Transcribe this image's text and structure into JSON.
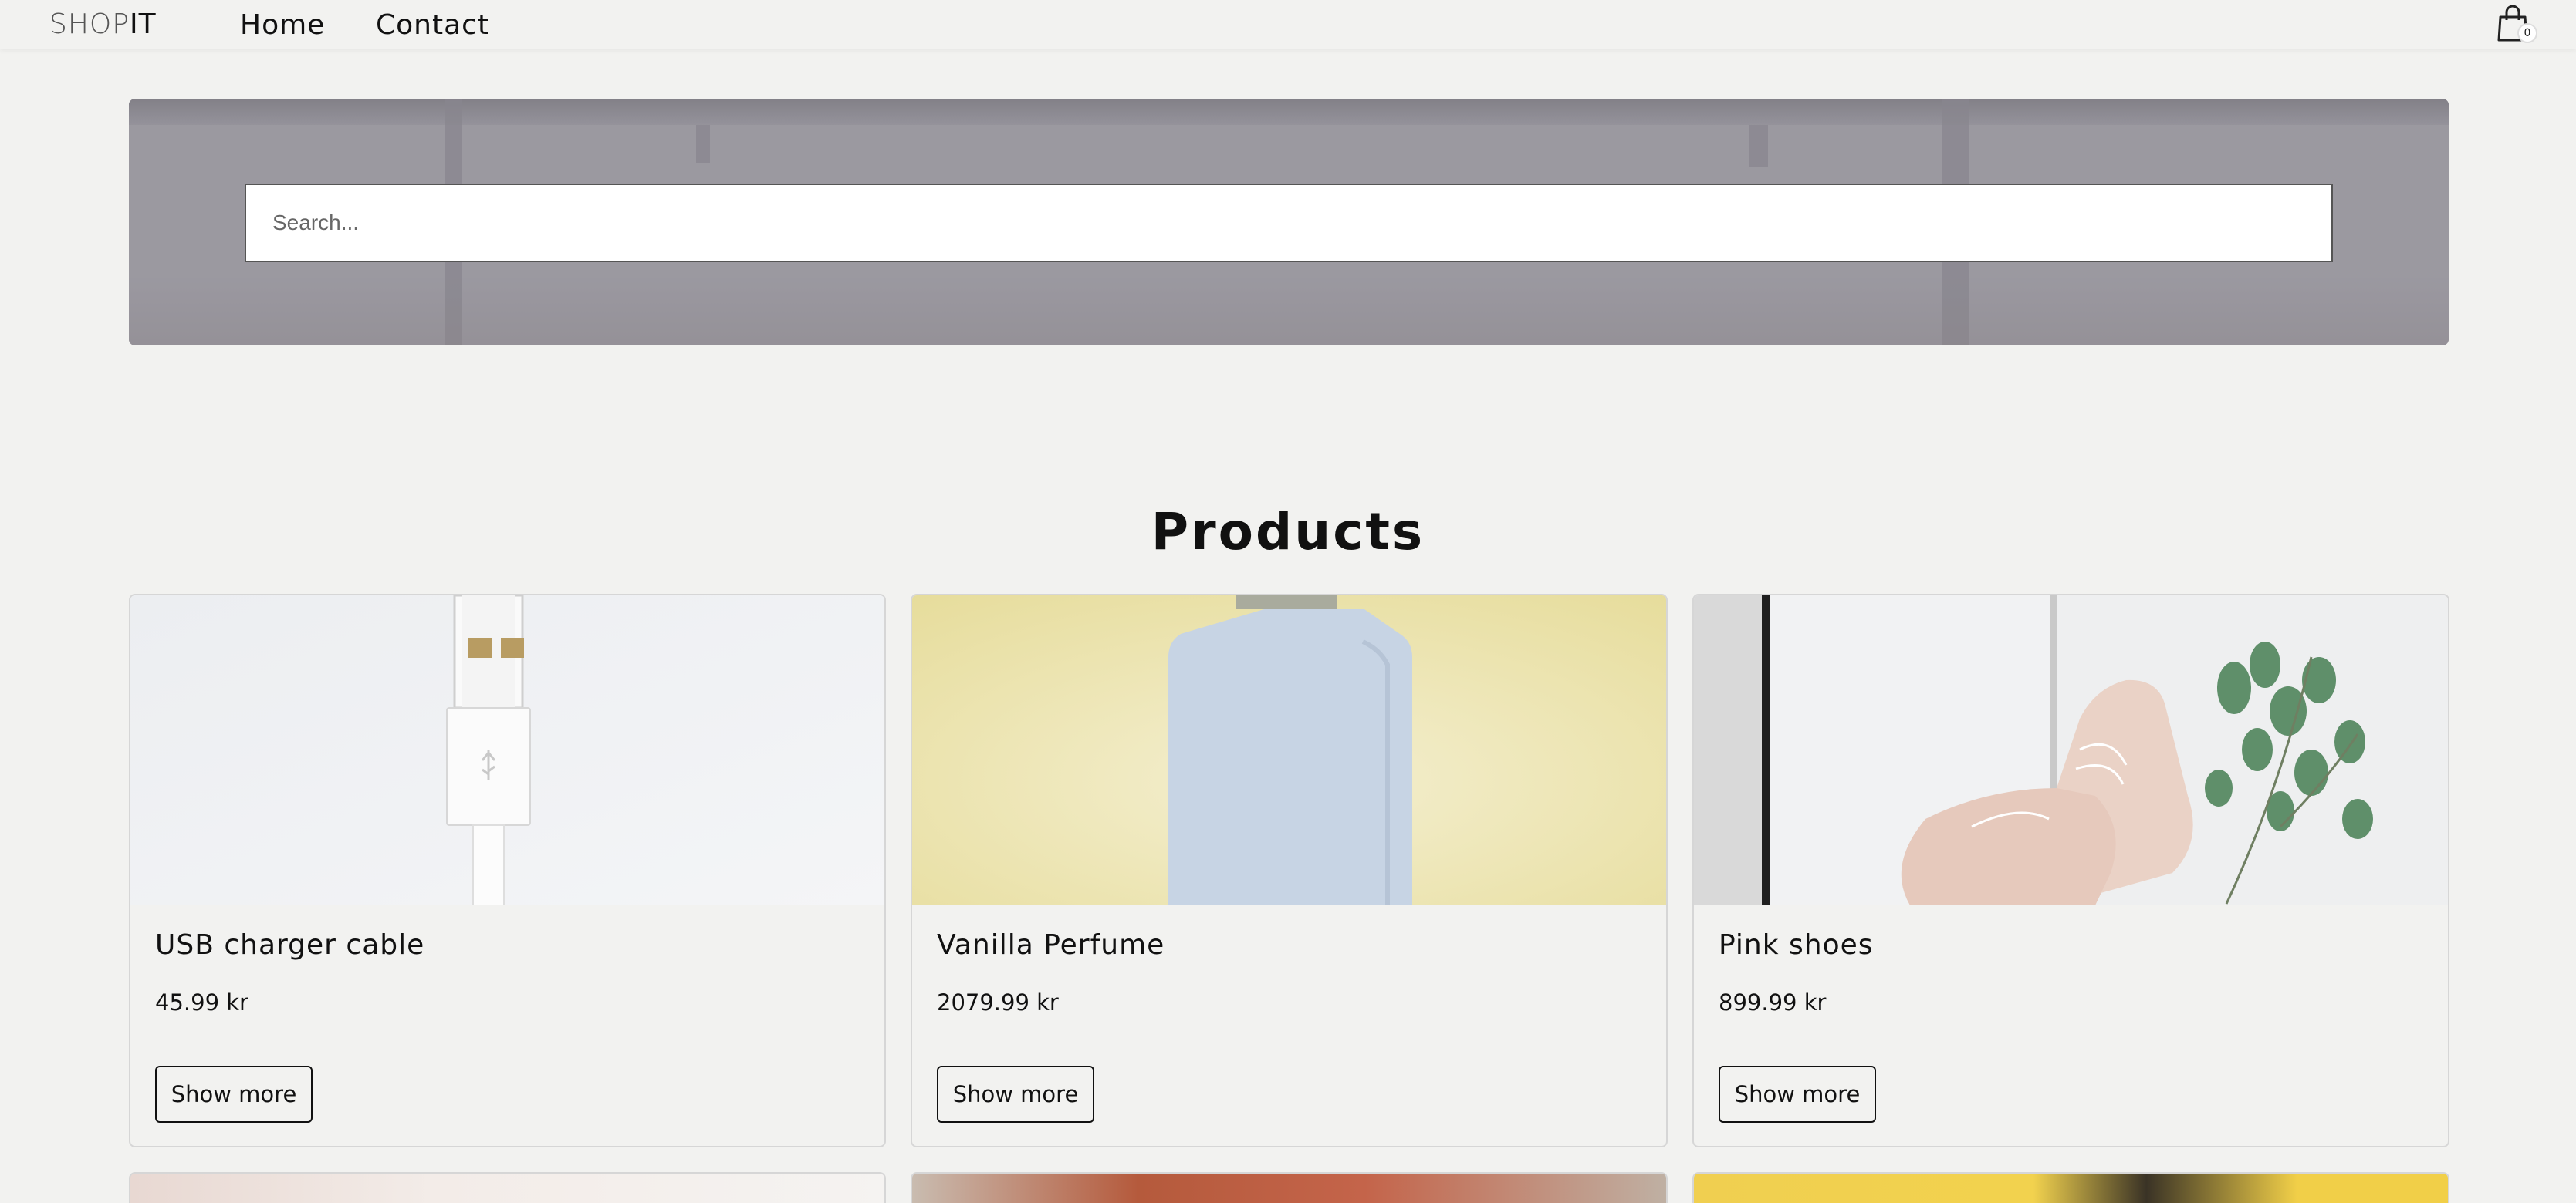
{
  "header": {
    "logo_part1": "SHOP",
    "logo_part2": "IT",
    "nav": {
      "home": "Home",
      "contact": "Contact"
    },
    "cart_count": "0"
  },
  "hero": {
    "search_placeholder": "Search..."
  },
  "products": {
    "title": "Products",
    "show_more_label": "Show more",
    "items": [
      {
        "name": "USB charger cable",
        "price": "45.99 kr",
        "image": "usb-cable-image"
      },
      {
        "name": "Vanilla Perfume",
        "price": "2079.99 kr",
        "image": "perfume-bottle-image"
      },
      {
        "name": "Pink shoes",
        "price": "899.99 kr",
        "image": "pink-shoes-image"
      }
    ]
  },
  "colors": {
    "background": "#f2f2f0",
    "text": "#111111",
    "border": "#d6d6d6"
  }
}
